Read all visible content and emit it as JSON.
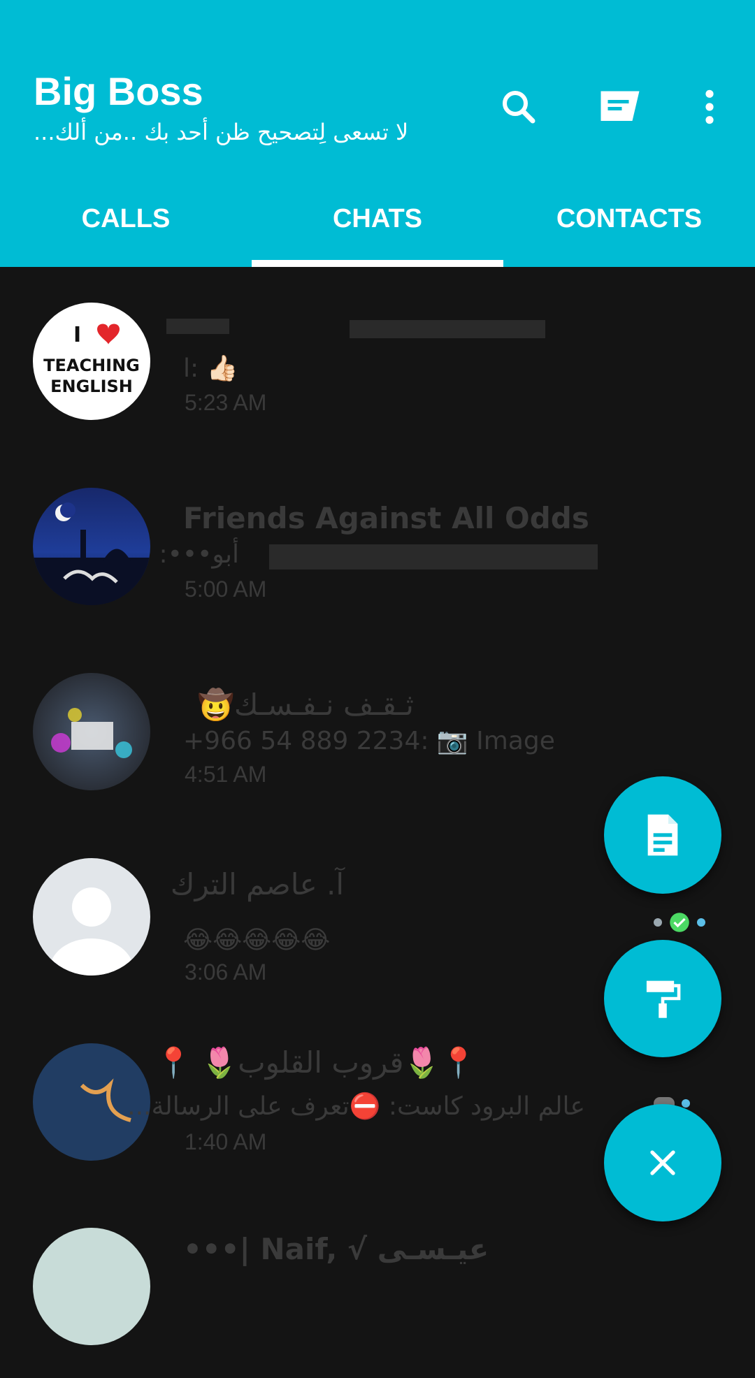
{
  "header": {
    "title": "Big Boss",
    "subtitle": "لا تسعى لِتصحيح ظن أحد بك ..من ألك...",
    "actions": [
      "search-icon",
      "compose-icon",
      "more-vert-icon"
    ]
  },
  "tabs": [
    {
      "label": "CALLS",
      "selected": false
    },
    {
      "label": "CHATS",
      "selected": true
    },
    {
      "label": "CONTACTS",
      "selected": false
    }
  ],
  "chats": [
    {
      "title": "",
      "message": "ا: 👍🏻",
      "time": "5:23 AM",
      "avatar_text": [
        "I",
        "TEACHING",
        "ENGLISH"
      ]
    },
    {
      "title": "Friends Against All Odds",
      "message": "أبو•••:",
      "time": "5:00 AM"
    },
    {
      "title": "ثـقـف نـفـسـك🤠",
      "message": "+966 54 889 2234: 📷 Image",
      "time": "4:51 AM"
    },
    {
      "title": "آ. عاصم الترك",
      "message": "😂😂😂😂😂",
      "time": "3:06 AM"
    },
    {
      "title": "📍🌷قروب القلوب🌷 📍",
      "message": "عالم البرود كاست: ⛔تعرف على الرسالة...",
      "time": "1:40 AM"
    },
    {
      "title": "•••| Naif, √ عيـسـى",
      "message": "",
      "time": ""
    }
  ],
  "fab": {
    "items": [
      "document-icon",
      "paint-roller-icon",
      "close-icon"
    ]
  },
  "colors": {
    "accent": "#00BCD4",
    "background": "#141414",
    "text_dim": "#3a3a3a",
    "check_green": "#4CD964"
  }
}
